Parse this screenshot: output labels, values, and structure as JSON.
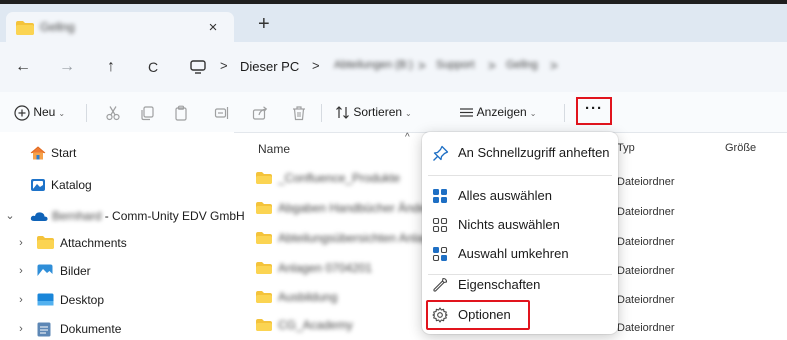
{
  "tab": {
    "title": "Gellng",
    "close_label": "×",
    "new_label": "+"
  },
  "nav": {
    "back": "←",
    "forward": "→",
    "up": "↑",
    "refresh": "C"
  },
  "breadcrumbs": [
    {
      "label": "Dieser PC",
      "blurred": false
    },
    {
      "label": "Abteilungen (B:)",
      "blurred": true
    },
    {
      "label": "Support",
      "blurred": true
    },
    {
      "label": "Gellng",
      "blurred": true
    }
  ],
  "breadcrumb_separator": ">",
  "toolbar": {
    "new_label": "Neu",
    "sort_label": "Sortieren",
    "view_label": "Anzeigen",
    "more_label": "···"
  },
  "sidebar": {
    "start": "Start",
    "katalog": "Katalog",
    "account_blurred": "Bernhard",
    "account_org": " - Comm-Unity EDV GmbH",
    "attachments": "Attachments",
    "bilder": "Bilder",
    "desktop": "Desktop",
    "dokumente": "Dokumente"
  },
  "columns": {
    "name": "Name",
    "type": "Typ",
    "size": "Größe"
  },
  "files": [
    {
      "name": "_Confluence_Produkte",
      "type": "Dateiordner"
    },
    {
      "name": "Abgaben Handbücher Änderungen",
      "type": "Dateiordner"
    },
    {
      "name": "Abteilungsübersichten Anlagen",
      "type": "Dateiordner"
    },
    {
      "name": "Anlagen 0704201",
      "type": "Dateiordner"
    },
    {
      "name": "Ausbildung",
      "type": "Dateiordner"
    },
    {
      "name": "CG_Academy",
      "type": "Dateiordner"
    }
  ],
  "menu": {
    "pin": "An Schnellzugriff anheften",
    "select_all": "Alles auswählen",
    "select_none": "Nichts auswählen",
    "invert": "Auswahl umkehren",
    "properties": "Eigenschaften",
    "options": "Optionen"
  },
  "colors": {
    "highlight": "#e1141d",
    "folder": "#f4c33b",
    "accent": "#0f6cbd"
  }
}
